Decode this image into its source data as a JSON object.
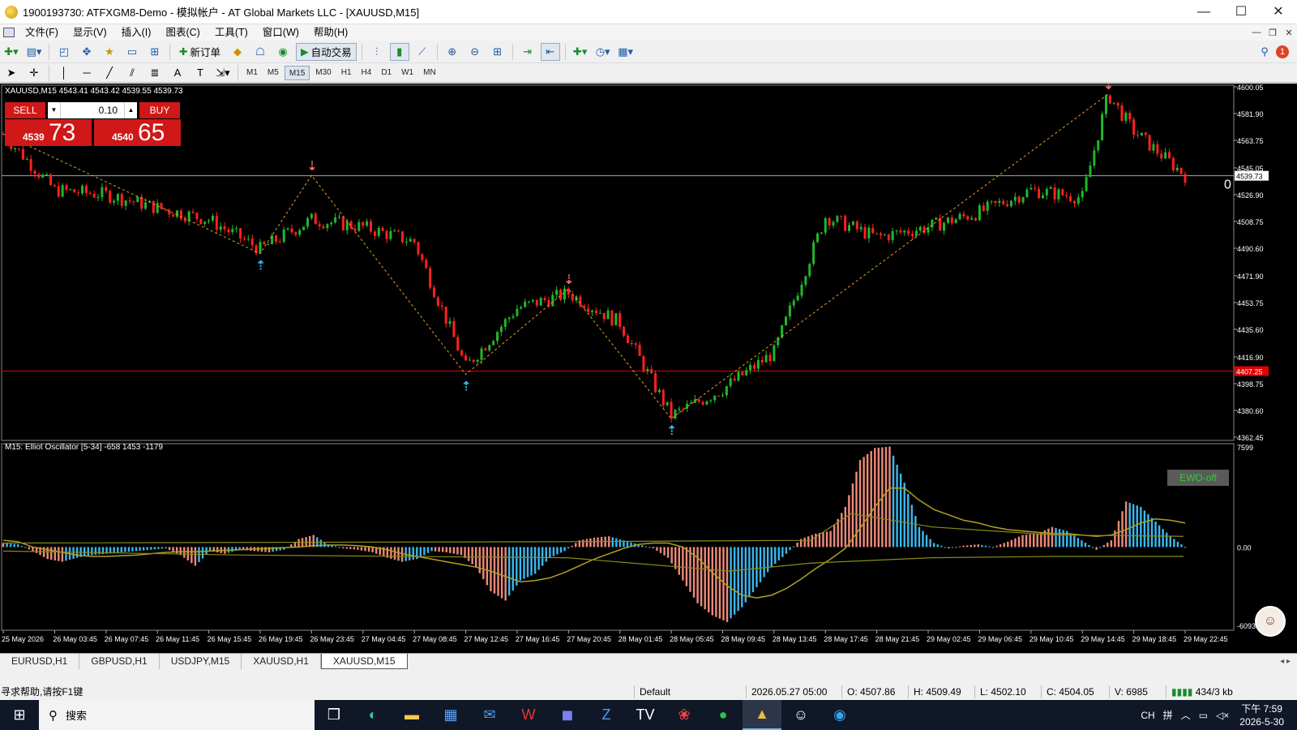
{
  "window": {
    "title": "1900193730: ATFXGM8-Demo - 模拟帐户 - AT Global Markets LLC - [XAUUSD,M15]",
    "min": "—",
    "max": "☐",
    "close": "✕"
  },
  "menu": [
    "文件(F)",
    "显示(V)",
    "插入(I)",
    "图表(C)",
    "工具(T)",
    "窗口(W)",
    "帮助(H)"
  ],
  "toolbar": {
    "new_order": "新订单",
    "auto_trading": "自动交易",
    "notification_count": "1"
  },
  "timeframes": [
    "M1",
    "M5",
    "M15",
    "M30",
    "H1",
    "H4",
    "D1",
    "W1",
    "MN"
  ],
  "active_timeframe": "M15",
  "chart": {
    "info": "XAUUSD,M15  4543.41 4543.42 4539.55 4539.73",
    "current_price": "4539.73",
    "level_price": "4407.25",
    "level_color": "#e00000",
    "right_edge_text": "0"
  },
  "one_click_trading": {
    "sell_label": "SELL",
    "buy_label": "BUY",
    "lot": "0.10",
    "sell_small": "4539",
    "sell_big": "73",
    "buy_small": "4540",
    "buy_big": "65"
  },
  "oscillator": {
    "info": "M15: Elliot Oscillator [5-34]  -658 1453 -1179",
    "top_label": "7599",
    "zero_label": "0.00",
    "bottom_label": "-6093",
    "ewo_button": "EWO-off"
  },
  "price_axis": [
    "4600.05",
    "4581.90",
    "4563.75",
    "4545.05",
    "4526.90",
    "4508.75",
    "4490.60",
    "4471.90",
    "4453.75",
    "4435.60",
    "4416.90",
    "4398.75",
    "4380.60",
    "4362.45"
  ],
  "time_axis": [
    "25 May 2026",
    "26 May 03:45",
    "26 May 07:45",
    "26 May 11:45",
    "26 May 15:45",
    "26 May 19:45",
    "26 May 23:45",
    "27 May 04:45",
    "27 May 08:45",
    "27 May 12:45",
    "27 May 16:45",
    "27 May 20:45",
    "28 May 01:45",
    "28 May 05:45",
    "28 May 09:45",
    "28 May 13:45",
    "28 May 17:45",
    "28 May 21:45",
    "29 May 02:45",
    "29 May 06:45",
    "29 May 10:45",
    "29 May 14:45",
    "29 May 18:45",
    "29 May 22:45"
  ],
  "chart_data": {
    "type": "candlestick",
    "symbol": "XAUUSD",
    "timeframe": "M15",
    "price_series": [
      {
        "t": "25 May 2026",
        "price": 4568
      },
      {
        "t": "26 May 03:45",
        "price": 4530
      },
      {
        "t": "26 May 07:45",
        "price": 4527
      },
      {
        "t": "26 May 11:45",
        "price": 4518
      },
      {
        "t": "26 May 15:45",
        "price": 4510
      },
      {
        "t": "26 May 19:45",
        "price": 4490
      },
      {
        "t": "26 May 23:45",
        "price": 4510
      },
      {
        "t": "27 May 04:45",
        "price": 4505
      },
      {
        "t": "27 May 08:45",
        "price": 4495
      },
      {
        "t": "27 May 12:45",
        "price": 4410
      },
      {
        "t": "27 May 16:45",
        "price": 4450
      },
      {
        "t": "27 May 20:45",
        "price": 4460
      },
      {
        "t": "28 May 01:45",
        "price": 4440
      },
      {
        "t": "28 May 05:45",
        "price": 4377
      },
      {
        "t": "28 May 09:45",
        "price": 4395
      },
      {
        "t": "28 May 13:45",
        "price": 4420
      },
      {
        "t": "28 May 17:45",
        "price": 4512
      },
      {
        "t": "28 May 21:45",
        "price": 4498
      },
      {
        "t": "29 May 02:45",
        "price": 4505
      },
      {
        "t": "29 May 06:45",
        "price": 4515
      },
      {
        "t": "29 May 10:45",
        "price": 4530
      },
      {
        "t": "29 May 14:45",
        "price": 4525
      },
      {
        "t": "29 May 16:45",
        "price": 4595
      },
      {
        "t": "29 May 18:45",
        "price": 4570
      },
      {
        "t": "29 May 22:45",
        "price": 4540
      }
    ],
    "zigzag": [
      {
        "t": "25 May 2026",
        "price": 4568
      },
      {
        "t": "26 May 19:45",
        "price": 4487
      },
      {
        "t": "26 May 23:45",
        "price": 4540
      },
      {
        "t": "27 May 12:45",
        "price": 4405
      },
      {
        "t": "27 May 20:45",
        "price": 4463
      },
      {
        "t": "28 May 05:45",
        "price": 4375
      },
      {
        "t": "29 May 16:45",
        "price": 4595
      }
    ],
    "signals": [
      {
        "t": "26 May 19:45",
        "type": "buy"
      },
      {
        "t": "26 May 23:45",
        "type": "sell"
      },
      {
        "t": "27 May 12:45",
        "type": "buy"
      },
      {
        "t": "27 May 20:45",
        "type": "sell"
      },
      {
        "t": "28 May 05:45",
        "type": "buy"
      },
      {
        "t": "29 May 16:45",
        "type": "sell"
      }
    ],
    "ylim": [
      4362.45,
      4600.05
    ],
    "oscillator": {
      "name": "Elliot Oscillator [5-34]",
      "values": [
        300,
        200,
        -300,
        -900,
        -1100,
        -800,
        -600,
        -500,
        -400,
        -300,
        -200,
        -100,
        -600,
        -1400,
        -300,
        -500,
        -200,
        -300,
        -400,
        -200,
        600,
        900,
        200,
        -100,
        -200,
        -400,
        -800,
        -1100,
        -900,
        -300,
        -400,
        -600,
        -1500,
        -3300,
        -4000,
        -2500,
        -2000,
        -800,
        -300,
        500,
        700,
        800,
        500,
        200,
        -100,
        -800,
        -2500,
        -4200,
        -5100,
        -5600,
        -4500,
        -3000,
        -1500,
        -500,
        600,
        1000,
        1200,
        3000,
        6500,
        7400,
        7500,
        4800,
        1500,
        300,
        -100,
        100,
        200,
        0,
        400,
        900,
        1000,
        1500,
        1200,
        500,
        -200,
        500,
        3400,
        3000,
        1900,
        800,
        0
      ],
      "signal_line": [
        500,
        400,
        0,
        -200,
        -400,
        -600,
        -700,
        -700,
        -650,
        -600,
        -500,
        -400,
        -350,
        -350,
        -300,
        -250,
        -200,
        -150,
        -100,
        -50,
        0,
        100,
        150,
        150,
        100,
        0,
        -200,
        -500,
        -700,
        -900,
        -1100,
        -1300,
        -1500,
        -1800,
        -2200,
        -2600,
        -2500,
        -2300,
        -1900,
        -1400,
        -900,
        -500,
        -100,
        200,
        300,
        300,
        0,
        -800,
        -1900,
        -2900,
        -3600,
        -3800,
        -3600,
        -3100,
        -2400,
        -1600,
        -900,
        -100,
        1400,
        3000,
        4400,
        4400,
        3500,
        2800,
        2400,
        2000,
        1800,
        1500,
        1300,
        1200,
        1100,
        1000,
        1000,
        900,
        800,
        900,
        1300,
        1800,
        2100,
        2000,
        1800
      ],
      "ylim": [
        -6093,
        7599
      ]
    }
  },
  "symbol_tabs": [
    "EURUSD,H1",
    "GBPUSD,H1",
    "USDJPY,M15",
    "XAUUSD,H1",
    "XAUUSD,M15"
  ],
  "active_tab": "XAUUSD,M15",
  "status": {
    "help": "寻求帮助,请按F1键",
    "profile": "Default",
    "datetime": "2026.05.27 05:00",
    "open": "O: 4507.86",
    "high": "H: 4509.49",
    "low": "L: 4502.10",
    "close": "C: 4504.05",
    "volume": "V: 6985",
    "traffic": "434/3 kb"
  },
  "taskbar": {
    "search_placeholder": "搜索",
    "clock_time": "下午 7:59",
    "clock_date": "2026-5-30",
    "lang": "CH",
    "ime": "拼"
  }
}
